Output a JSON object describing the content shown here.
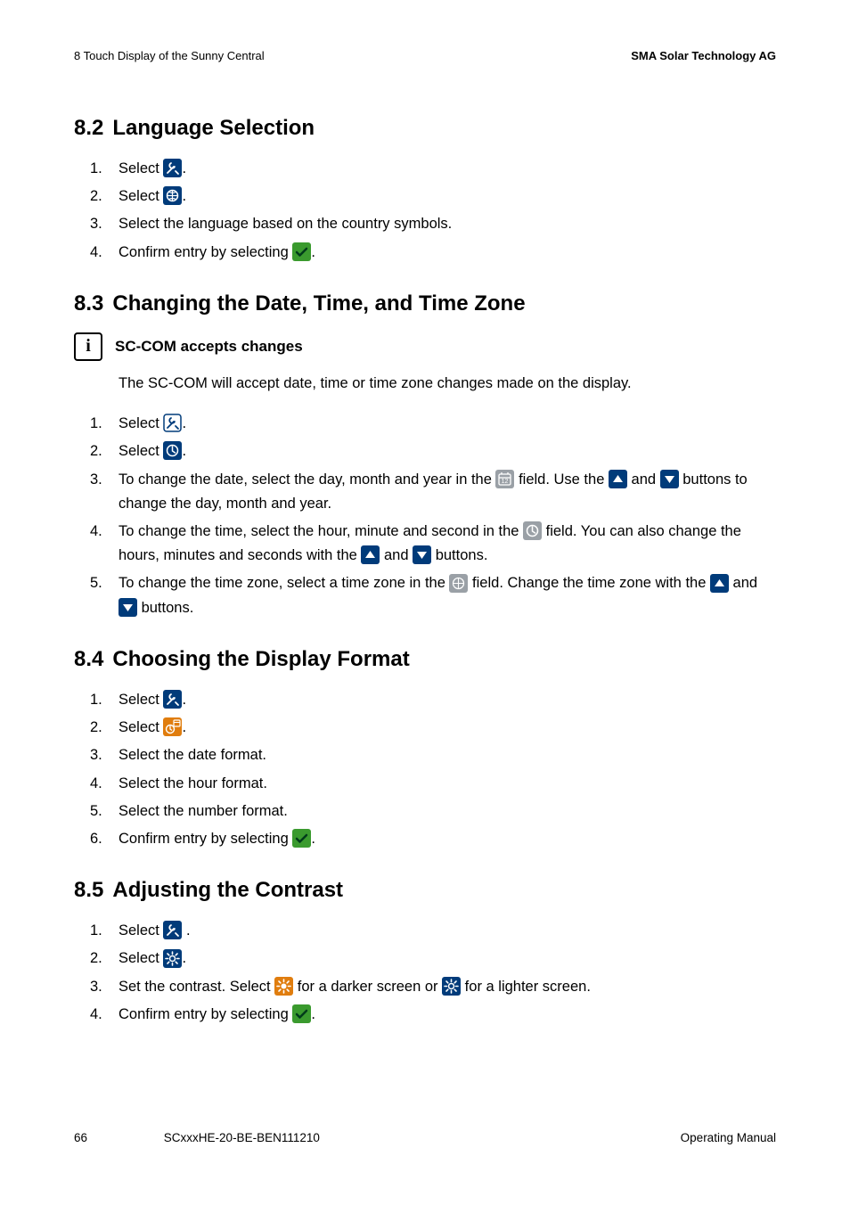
{
  "header": {
    "left": "8  Touch Display of the Sunny Central",
    "right": "SMA Solar Technology AG"
  },
  "sections": {
    "s82": {
      "num": "8.2",
      "title": "Language Selection"
    },
    "s83": {
      "num": "8.3",
      "title": "Changing the Date, Time, and Time Zone"
    },
    "s84": {
      "num": "8.4",
      "title": "Choosing the Display Format"
    },
    "s85": {
      "num": "8.5",
      "title": "Adjusting the Contrast"
    }
  },
  "info": {
    "title": "SC-COM accepts changes",
    "body": "The SC-COM will accept date, time or time zone changes made on the display."
  },
  "steps": {
    "s82": {
      "1a": "Select ",
      "1b": ".",
      "2a": "Select ",
      "2b": ".",
      "3": "Select the language based on the country symbols.",
      "4a": "Confirm entry by selecting ",
      "4b": "."
    },
    "s83": {
      "1a": "Select ",
      "1b": ".",
      "2a": "Select ",
      "2b": ".",
      "3a": "To change the date, select the day, month and year in the ",
      "3b": " field. Use the ",
      "3c": " and ",
      "3d": " buttons to change the day, month and year.",
      "4a": "To change the time, select the hour, minute and second in the ",
      "4b": " field. You can also change the hours, minutes and seconds with the ",
      "4c": " and ",
      "4d": " buttons.",
      "5a": "To change the time zone, select a time zone in the ",
      "5b": " field. Change the time zone with the ",
      "5c": " and ",
      "5d": " buttons."
    },
    "s84": {
      "1a": "Select ",
      "1b": ".",
      "2a": "Select ",
      "2b": ".",
      "3": "Select the date format.",
      "4": "Select the hour format.",
      "5": "Select the number format.",
      "6a": "Confirm entry by selecting ",
      "6b": "."
    },
    "s85": {
      "1a": "Select ",
      "1b": " .",
      "2a": "Select ",
      "2b": ".",
      "3a": "Set the contrast. Select ",
      "3b": " for a darker screen or ",
      "3c": " for a lighter screen.",
      "4a": "Confirm entry by selecting ",
      "4b": "."
    }
  },
  "footer": {
    "page": "66",
    "docid": "SCxxxHE-20-BE-BEN111210",
    "type": "Operating Manual"
  }
}
